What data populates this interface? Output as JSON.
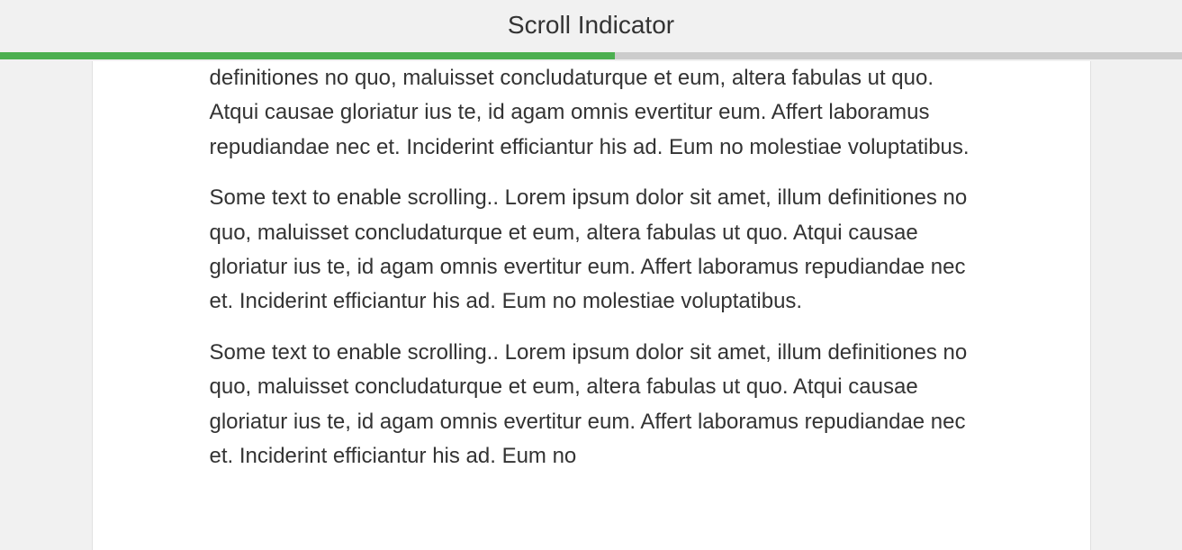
{
  "header": {
    "title": "Scroll Indicator"
  },
  "progress": {
    "percent": 52,
    "bar_color": "#4caf50",
    "track_color": "#ccc"
  },
  "content": {
    "paragraphs": [
      "definitiones no quo, maluisset concludaturque et eum, altera fabulas ut quo. Atqui causae gloriatur ius te, id agam omnis evertitur eum. Affert laboramus repudiandae nec et. Inciderint efficiantur his ad. Eum no molestiae voluptatibus.",
      "Some text to enable scrolling.. Lorem ipsum dolor sit amet, illum definitiones no quo, maluisset concludaturque et eum, altera fabulas ut quo. Atqui causae gloriatur ius te, id agam omnis evertitur eum. Affert laboramus repudiandae nec et. Inciderint efficiantur his ad. Eum no molestiae voluptatibus.",
      "Some text to enable scrolling.. Lorem ipsum dolor sit amet, illum definitiones no quo, maluisset concludaturque et eum, altera fabulas ut quo. Atqui causae gloriatur ius te, id agam omnis evertitur eum. Affert laboramus repudiandae nec et. Inciderint efficiantur his ad. Eum no"
    ]
  }
}
